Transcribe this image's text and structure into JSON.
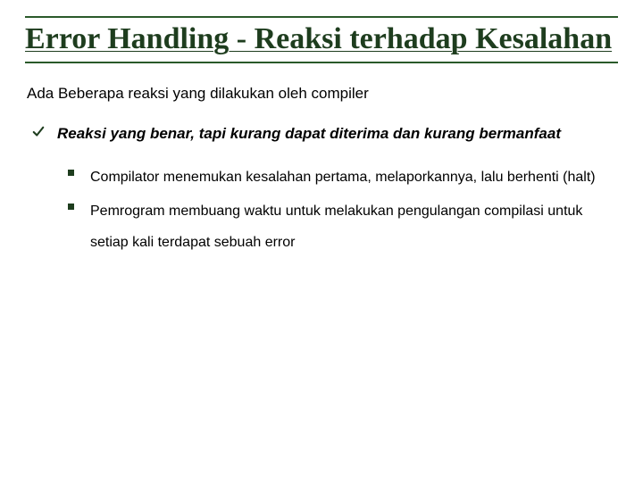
{
  "title": "Error Handling - Reaksi terhadap Kesalahan",
  "intro": "Ada Beberapa reaksi yang dilakukan oleh compiler",
  "subhead": "Reaksi yang benar, tapi kurang dapat diterima dan kurang bermanfaat",
  "bullets": [
    "Compilator menemukan kesalahan pertama, melaporkannya, lalu berhenti (halt)",
    "Pemrogram membuang waktu untuk melakukan pengulangan compilasi untuk setiap kali terdapat sebuah error"
  ]
}
